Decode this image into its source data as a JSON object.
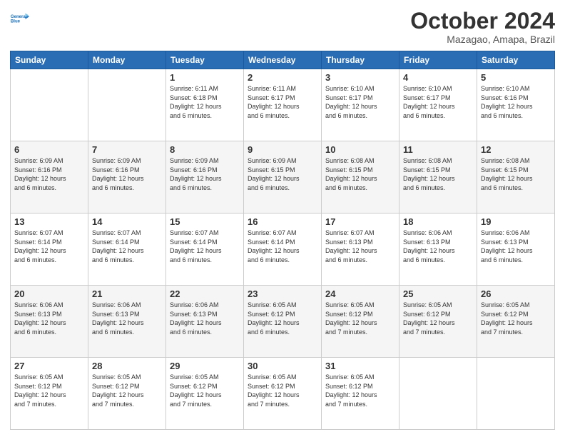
{
  "logo": {
    "line1": "General",
    "line2": "Blue"
  },
  "title": "October 2024",
  "subtitle": "Mazagao, Amapa, Brazil",
  "days_of_week": [
    "Sunday",
    "Monday",
    "Tuesday",
    "Wednesday",
    "Thursday",
    "Friday",
    "Saturday"
  ],
  "weeks": [
    [
      {
        "day": "",
        "info": ""
      },
      {
        "day": "",
        "info": ""
      },
      {
        "day": "1",
        "info": "Sunrise: 6:11 AM\nSunset: 6:18 PM\nDaylight: 12 hours\nand 6 minutes."
      },
      {
        "day": "2",
        "info": "Sunrise: 6:11 AM\nSunset: 6:17 PM\nDaylight: 12 hours\nand 6 minutes."
      },
      {
        "day": "3",
        "info": "Sunrise: 6:10 AM\nSunset: 6:17 PM\nDaylight: 12 hours\nand 6 minutes."
      },
      {
        "day": "4",
        "info": "Sunrise: 6:10 AM\nSunset: 6:17 PM\nDaylight: 12 hours\nand 6 minutes."
      },
      {
        "day": "5",
        "info": "Sunrise: 6:10 AM\nSunset: 6:16 PM\nDaylight: 12 hours\nand 6 minutes."
      }
    ],
    [
      {
        "day": "6",
        "info": "Sunrise: 6:09 AM\nSunset: 6:16 PM\nDaylight: 12 hours\nand 6 minutes."
      },
      {
        "day": "7",
        "info": "Sunrise: 6:09 AM\nSunset: 6:16 PM\nDaylight: 12 hours\nand 6 minutes."
      },
      {
        "day": "8",
        "info": "Sunrise: 6:09 AM\nSunset: 6:16 PM\nDaylight: 12 hours\nand 6 minutes."
      },
      {
        "day": "9",
        "info": "Sunrise: 6:09 AM\nSunset: 6:15 PM\nDaylight: 12 hours\nand 6 minutes."
      },
      {
        "day": "10",
        "info": "Sunrise: 6:08 AM\nSunset: 6:15 PM\nDaylight: 12 hours\nand 6 minutes."
      },
      {
        "day": "11",
        "info": "Sunrise: 6:08 AM\nSunset: 6:15 PM\nDaylight: 12 hours\nand 6 minutes."
      },
      {
        "day": "12",
        "info": "Sunrise: 6:08 AM\nSunset: 6:15 PM\nDaylight: 12 hours\nand 6 minutes."
      }
    ],
    [
      {
        "day": "13",
        "info": "Sunrise: 6:07 AM\nSunset: 6:14 PM\nDaylight: 12 hours\nand 6 minutes."
      },
      {
        "day": "14",
        "info": "Sunrise: 6:07 AM\nSunset: 6:14 PM\nDaylight: 12 hours\nand 6 minutes."
      },
      {
        "day": "15",
        "info": "Sunrise: 6:07 AM\nSunset: 6:14 PM\nDaylight: 12 hours\nand 6 minutes."
      },
      {
        "day": "16",
        "info": "Sunrise: 6:07 AM\nSunset: 6:14 PM\nDaylight: 12 hours\nand 6 minutes."
      },
      {
        "day": "17",
        "info": "Sunrise: 6:07 AM\nSunset: 6:13 PM\nDaylight: 12 hours\nand 6 minutes."
      },
      {
        "day": "18",
        "info": "Sunrise: 6:06 AM\nSunset: 6:13 PM\nDaylight: 12 hours\nand 6 minutes."
      },
      {
        "day": "19",
        "info": "Sunrise: 6:06 AM\nSunset: 6:13 PM\nDaylight: 12 hours\nand 6 minutes."
      }
    ],
    [
      {
        "day": "20",
        "info": "Sunrise: 6:06 AM\nSunset: 6:13 PM\nDaylight: 12 hours\nand 6 minutes."
      },
      {
        "day": "21",
        "info": "Sunrise: 6:06 AM\nSunset: 6:13 PM\nDaylight: 12 hours\nand 6 minutes."
      },
      {
        "day": "22",
        "info": "Sunrise: 6:06 AM\nSunset: 6:13 PM\nDaylight: 12 hours\nand 6 minutes."
      },
      {
        "day": "23",
        "info": "Sunrise: 6:05 AM\nSunset: 6:12 PM\nDaylight: 12 hours\nand 6 minutes."
      },
      {
        "day": "24",
        "info": "Sunrise: 6:05 AM\nSunset: 6:12 PM\nDaylight: 12 hours\nand 7 minutes."
      },
      {
        "day": "25",
        "info": "Sunrise: 6:05 AM\nSunset: 6:12 PM\nDaylight: 12 hours\nand 7 minutes."
      },
      {
        "day": "26",
        "info": "Sunrise: 6:05 AM\nSunset: 6:12 PM\nDaylight: 12 hours\nand 7 minutes."
      }
    ],
    [
      {
        "day": "27",
        "info": "Sunrise: 6:05 AM\nSunset: 6:12 PM\nDaylight: 12 hours\nand 7 minutes."
      },
      {
        "day": "28",
        "info": "Sunrise: 6:05 AM\nSunset: 6:12 PM\nDaylight: 12 hours\nand 7 minutes."
      },
      {
        "day": "29",
        "info": "Sunrise: 6:05 AM\nSunset: 6:12 PM\nDaylight: 12 hours\nand 7 minutes."
      },
      {
        "day": "30",
        "info": "Sunrise: 6:05 AM\nSunset: 6:12 PM\nDaylight: 12 hours\nand 7 minutes."
      },
      {
        "day": "31",
        "info": "Sunrise: 6:05 AM\nSunset: 6:12 PM\nDaylight: 12 hours\nand 7 minutes."
      },
      {
        "day": "",
        "info": ""
      },
      {
        "day": "",
        "info": ""
      }
    ]
  ]
}
